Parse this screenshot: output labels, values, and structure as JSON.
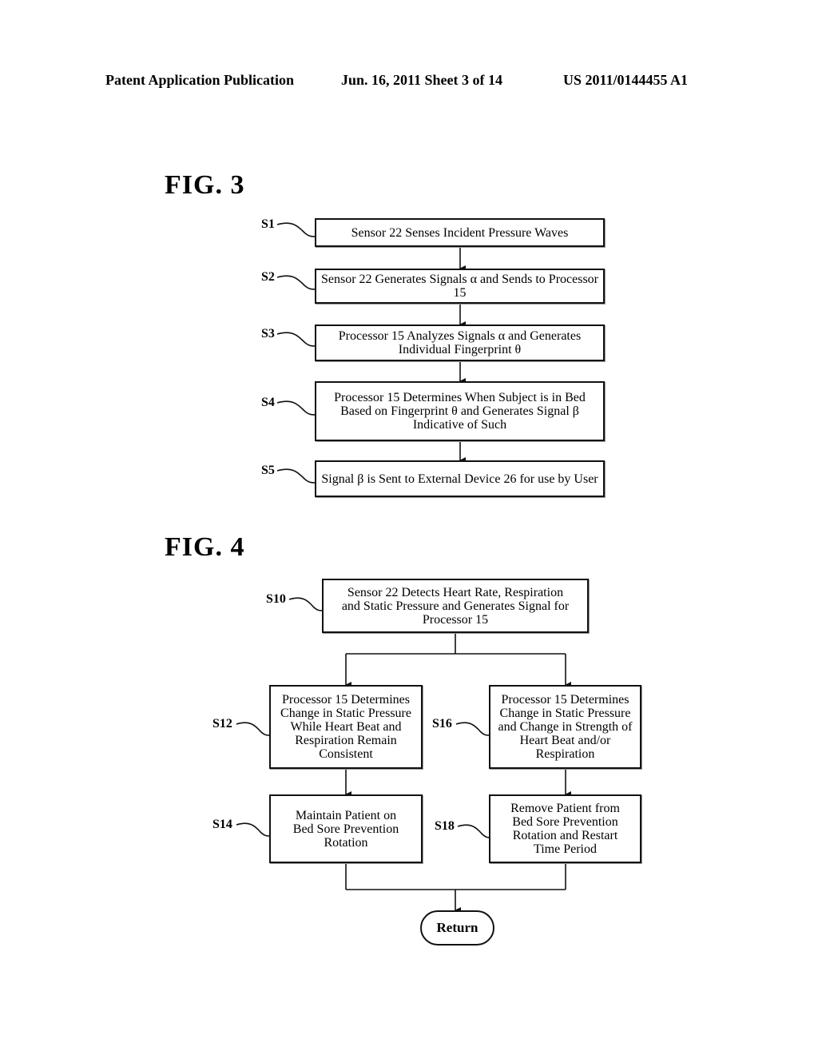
{
  "header": {
    "left": "Patent Application Publication",
    "date_sheet": "Jun. 16, 2011  Sheet 3 of 14",
    "pub_number": "US 2011/0144455 A1"
  },
  "fig3": {
    "title": "FIG.  3",
    "steps": [
      {
        "label": "S1",
        "text": "Sensor 22 Senses Incident Pressure Waves"
      },
      {
        "label": "S2",
        "text": "Sensor 22 Generates Signals α and Sends to Processor 15"
      },
      {
        "label": "S3",
        "text": "Processor 15 Analyzes Signals α and Generates Individual Fingerprint θ"
      },
      {
        "label": "S4",
        "text": "Processor 15 Determines When Subject is in Bed Based on Fingerprint θ and Generates Signal β Indicative of Such"
      },
      {
        "label": "S5",
        "text": "Signal β is Sent to External Device 26 for use by User"
      }
    ]
  },
  "fig4": {
    "title": "FIG.  4",
    "start": {
      "label": "S10",
      "text": "Sensor 22 Detects Heart Rate, Respiration and Static Pressure and Generates Signal for Processor 15"
    },
    "left_branch": [
      {
        "label": "S12",
        "text": "Processor 15 Determines Change in Static Pressure While Heart Beat and Respiration Remain Consistent"
      },
      {
        "label": "S14",
        "text": "Maintain Patient on Bed Sore Prevention Rotation"
      }
    ],
    "right_branch": [
      {
        "label": "S16",
        "text": "Processor 15 Determines Change in Static Pressure and Change in Strength of Heart Beat and/or Respiration"
      },
      {
        "label": "S18",
        "text": "Remove Patient from Bed Sore Prevention Rotation and Restart Time Period"
      }
    ],
    "end": {
      "text": "Return"
    }
  }
}
